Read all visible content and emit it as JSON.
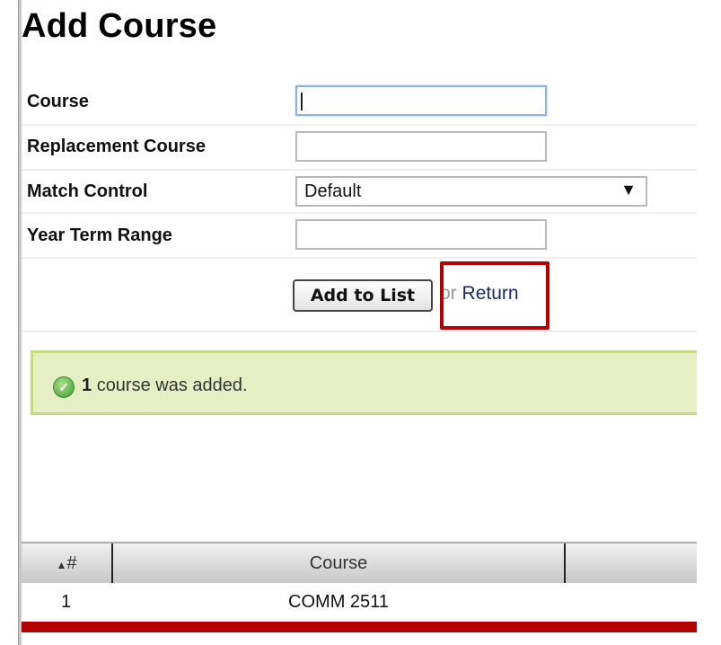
{
  "page": {
    "title": "Add Course"
  },
  "form": {
    "fields": [
      {
        "label": "Course",
        "value": "",
        "focused": true
      },
      {
        "label": "Replacement Course",
        "value": ""
      },
      {
        "label": "Match Control",
        "type": "select",
        "selected": "Default"
      },
      {
        "label": "Year Term Range",
        "value": ""
      }
    ],
    "add_button": "Add to List",
    "or_text": "or",
    "return_link": "Return"
  },
  "notice": {
    "icon": "check-circle-icon",
    "count": "1",
    "message": "course was added."
  },
  "table": {
    "columns": [
      {
        "label": "#",
        "sort": "ascending",
        "sort_icon": "▲"
      },
      {
        "label": "Course"
      },
      {
        "label": ""
      }
    ],
    "rows": [
      {
        "num": "1",
        "course": "COMM 2511",
        "extra": ""
      }
    ]
  },
  "colors": {
    "highlight_box": "#b40000",
    "notice_bg": "#e5efc3",
    "notice_border": "#c4da82",
    "bottom_bar": "#b40000"
  }
}
